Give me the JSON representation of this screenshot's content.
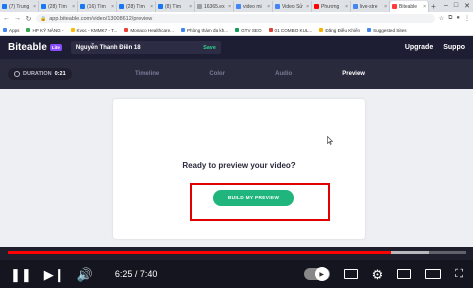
{
  "browser": {
    "tabs": [
      {
        "label": "(7) Trung",
        "color": "#1877f2"
      },
      {
        "label": "(28) Tìm",
        "color": "#1877f2"
      },
      {
        "label": "(16) Tìm",
        "color": "#1877f2"
      },
      {
        "label": "(28) Tìm",
        "color": "#1877f2"
      },
      {
        "label": "(8) Tìm",
        "color": "#1877f2"
      },
      {
        "label": "16365.ex",
        "color": "#9aa0a6"
      },
      {
        "label": "video mi",
        "color": "#4285f4"
      },
      {
        "label": "Video Sử",
        "color": "#4285f4"
      },
      {
        "label": "Phương",
        "color": "#ff0000"
      },
      {
        "label": "live-stre",
        "color": "#4285f4"
      },
      {
        "label": "Biteable",
        "color": "#ff3b3b",
        "active": true
      }
    ],
    "new_tab": "+",
    "window_controls": [
      "–",
      "□",
      "✕"
    ],
    "url": "app.biteable.com/video/13008612/preview",
    "bookmarks": [
      "Apps",
      "HP KỸ NĂNG -",
      "Kvoc - KMMK7 - T...",
      "Monaco Healthcare...",
      "Phòng thám đa kh...",
      "GTV SEO",
      "01 COMBO KUL...",
      "Đăng Điều Khiển",
      "Suggested Sites"
    ],
    "bookmark_colors": [
      "#4285f4",
      "#34a853",
      "#fbbc05",
      "#ea4335",
      "#4285f4",
      "#0f9d58",
      "#db4437",
      "#f4b400",
      "#4285f4"
    ]
  },
  "app": {
    "logo": "Biteable",
    "badge": "Lite",
    "video_title": "Nguyễn Thanh Điền 18",
    "save_label": "Save",
    "nav": [
      "Upgrade",
      "Suppo"
    ]
  },
  "toolbar": {
    "duration_label": "DURATION",
    "duration_value": "0:21",
    "steps": [
      "Timeline",
      "Color",
      "Audio",
      "Preview"
    ],
    "active_step": "Preview"
  },
  "preview": {
    "heading": "Ready to preview your video?",
    "build_button": "BUILD MY PREVIEW"
  },
  "player": {
    "current_time": "6:25",
    "total_time": "7:40",
    "time_text": "6:25 / 7:40",
    "progress_fraction": 0.837,
    "buffered_fraction": 0.92
  },
  "colors": {
    "accent_green": "#1fb57d",
    "save_green": "#2ecf8e",
    "highlight_red": "#e00000",
    "header_bg": "#1d1d33"
  }
}
